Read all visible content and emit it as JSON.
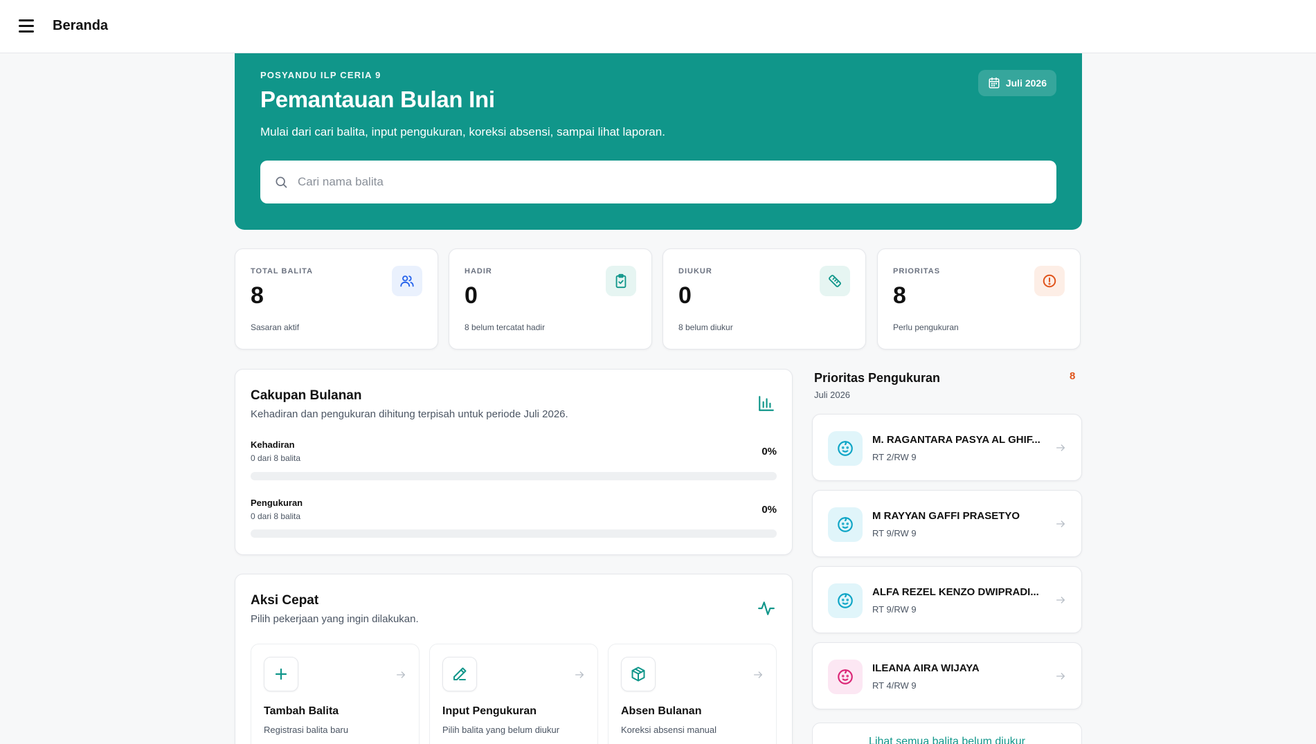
{
  "topbar": {
    "title": "Beranda"
  },
  "hero": {
    "kicker": "POSYANDU ILP CERIA 9",
    "title": "Pemantauan Bulan Ini",
    "subtitle": "Mulai dari cari balita, input pengukuran, koreksi absensi, sampai lihat laporan.",
    "month": "Juli 2026",
    "search_placeholder": "Cari nama balita",
    "search_value": ""
  },
  "stats": [
    {
      "label": "TOTAL BALITA",
      "value": "8",
      "note": "Sasaran aktif",
      "icon": "users-icon",
      "color": "#2563eb"
    },
    {
      "label": "HADIR",
      "value": "0",
      "note": "8 belum tercatat hadir",
      "icon": "clipboard-check-icon",
      "color": "#10968a"
    },
    {
      "label": "DIUKUR",
      "value": "0",
      "note": "8 belum diukur",
      "icon": "ruler-icon",
      "color": "#10968a"
    },
    {
      "label": "PRIORITAS",
      "value": "8",
      "note": "Perlu pengukuran",
      "icon": "alert-circle-icon",
      "color": "#e0541b"
    }
  ],
  "coverage": {
    "title": "Cakupan Bulanan",
    "subtitle": "Kehadiran dan pengukuran dihitung terpisah untuk periode Juli 2026.",
    "metrics": [
      {
        "name": "Kehadiran",
        "count": "0 dari 8 balita",
        "percent": "0%",
        "fraction": 0
      },
      {
        "name": "Pengukuran",
        "count": "0 dari 8 balita",
        "percent": "0%",
        "fraction": 0
      }
    ]
  },
  "quick_actions": {
    "title": "Aksi Cepat",
    "subtitle": "Pilih pekerjaan yang ingin dilakukan.",
    "items": [
      {
        "title": "Tambah Balita",
        "subtitle": "Registrasi balita baru",
        "icon": "plus-icon"
      },
      {
        "title": "Input Pengukuran",
        "subtitle": "Pilih balita yang belum diukur",
        "icon": "pencil-icon"
      },
      {
        "title": "Absen Bulanan",
        "subtitle": "Koreksi absensi manual",
        "icon": "package-icon"
      }
    ]
  },
  "priority": {
    "title": "Prioritas Pengukuran",
    "count": "8",
    "month": "Juli 2026",
    "items": [
      {
        "name": "M. RAGANTARA PASYA AL GHIF...",
        "location": "RT 2/RW 9",
        "avatar_color": "#0ea5c6",
        "avatar_bg": "#e0f5fa"
      },
      {
        "name": "M RAYYAN GAFFI PRASETYO",
        "location": "RT 9/RW 9",
        "avatar_color": "#0ea5c6",
        "avatar_bg": "#e0f5fa"
      },
      {
        "name": "ALFA REZEL KENZO DWIPRADI...",
        "location": "RT 9/RW 9",
        "avatar_color": "#0ea5c6",
        "avatar_bg": "#e0f5fa"
      },
      {
        "name": "ILEANA AIRA WIJAYA",
        "location": "RT 4/RW 9",
        "avatar_color": "#db2777",
        "avatar_bg": "#fce7f3"
      }
    ],
    "view_all": "Lihat semua balita belum diukur"
  }
}
